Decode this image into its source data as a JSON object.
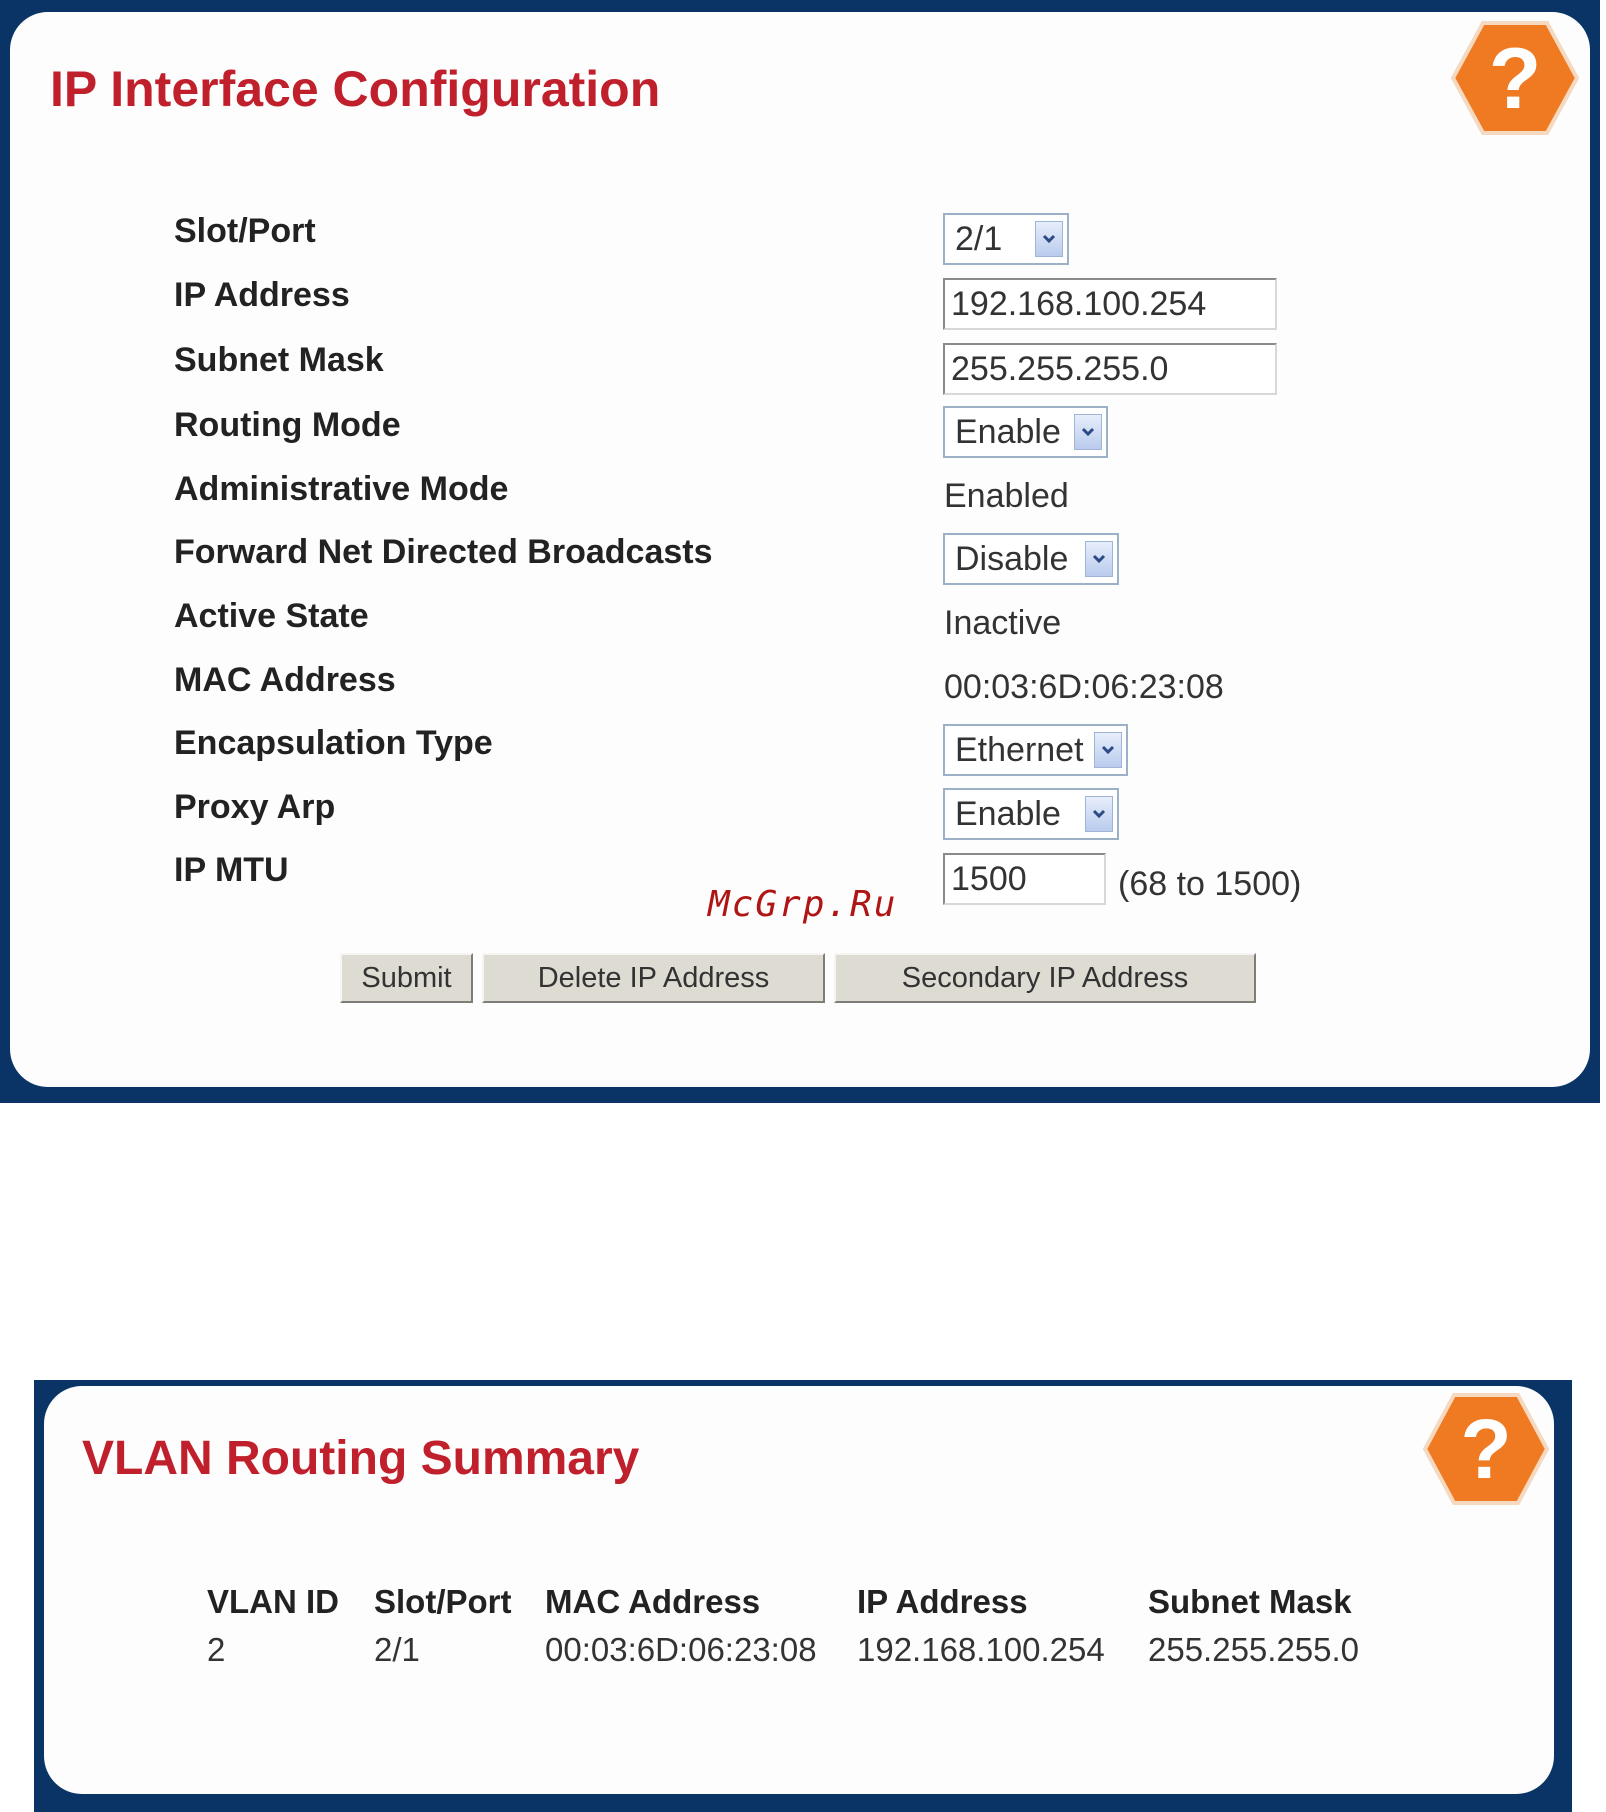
{
  "ip_config": {
    "title": "IP Interface Configuration",
    "fields": {
      "slot_port": {
        "label": "Slot/Port",
        "value": "2/1"
      },
      "ip_address": {
        "label": "IP Address",
        "value": "192.168.100.254"
      },
      "subnet_mask": {
        "label": "Subnet Mask",
        "value": "255.255.255.0"
      },
      "routing_mode": {
        "label": "Routing Mode",
        "value": "Enable"
      },
      "admin_mode": {
        "label": "Administrative Mode",
        "value": "Enabled"
      },
      "fwd_broadcasts": {
        "label": "Forward Net Directed Broadcasts",
        "value": "Disable"
      },
      "active_state": {
        "label": "Active State",
        "value": "Inactive"
      },
      "mac_address": {
        "label": "MAC Address",
        "value": "00:03:6D:06:23:08"
      },
      "encapsulation": {
        "label": "Encapsulation Type",
        "value": "Ethernet"
      },
      "proxy_arp": {
        "label": "Proxy Arp",
        "value": "Enable"
      },
      "ip_mtu": {
        "label": "IP MTU",
        "value": "1500",
        "hint": "(68 to 1500)"
      }
    },
    "buttons": {
      "submit": "Submit",
      "delete": "Delete IP Address",
      "secondary": "Secondary IP Address"
    }
  },
  "watermark": "McGrp.Ru",
  "vlan_summary": {
    "title": "VLAN Routing Summary",
    "columns": [
      "VLAN ID",
      "Slot/Port",
      "MAC Address",
      "IP Address",
      "Subnet Mask"
    ],
    "rows": [
      [
        "2",
        "2/1",
        "00:03:6D:06:23:08",
        "192.168.100.254",
        "255.255.255.0"
      ]
    ]
  },
  "colors": {
    "frame": "#0b3466",
    "title": "#c0202c",
    "help_icon": "#f07a22"
  },
  "icons": {
    "help": "help-question-icon",
    "dropdown": "chevron-down-icon"
  }
}
